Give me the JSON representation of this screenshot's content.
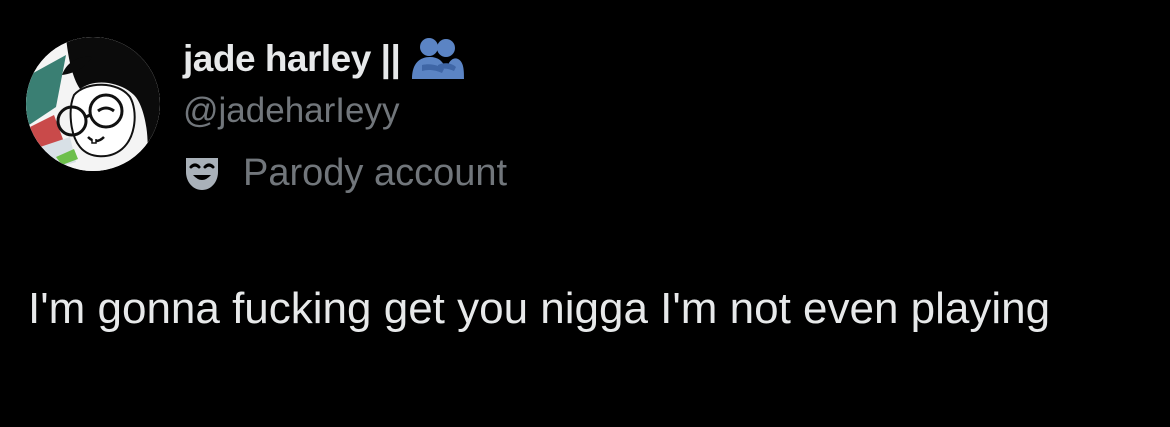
{
  "author": {
    "display_name": "jade harley ||",
    "handle": "@jadeharIeyy",
    "account_label": "Parody account",
    "avatar_icon": "cartoon-avatar-icon",
    "badge_icon": "people-hugging-icon",
    "label_icon": "performing-arts-mask-icon"
  },
  "tweet": {
    "text": "I'm gonna fucking get you nigga I'm not even playing"
  },
  "colors": {
    "background": "#000000",
    "primary_text": "#e7e9ea",
    "secondary_text": "#71767b",
    "emoji_blue": "#5b84c4"
  }
}
